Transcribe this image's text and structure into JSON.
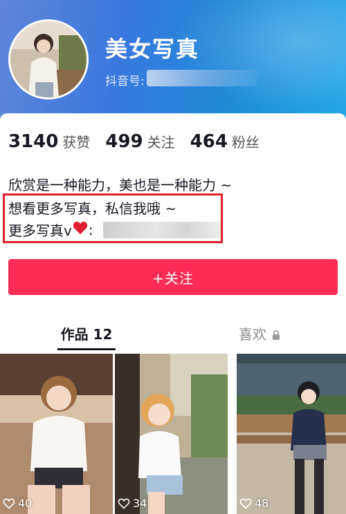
{
  "profile": {
    "name": "美女写真",
    "douyin_id_label": "抖音号:"
  },
  "stats": [
    {
      "value": "3140",
      "label": "获赞"
    },
    {
      "value": "499",
      "label": "关注"
    },
    {
      "value": "464",
      "label": "粉丝"
    }
  ],
  "bio": {
    "line1": "欣赏是一种能力，美也是一种能力 ~",
    "line2": "想看更多写真，私信我哦 ~",
    "line3_prefix": "更多写真v",
    "line3_suffix": ":"
  },
  "follow_button": {
    "label": "+关注"
  },
  "tabs": {
    "works": "作品 12",
    "likes": "喜欢"
  },
  "videos": [
    {
      "likes": "40"
    },
    {
      "likes": "34"
    },
    {
      "likes": "48"
    }
  ],
  "colors": {
    "accent": "#fe2c55",
    "highlight_border": "#e0202a",
    "header_blue": "#3a78e0"
  },
  "icons": [
    "heart-emoji-icon",
    "lock-icon",
    "heart-outline-icon"
  ]
}
